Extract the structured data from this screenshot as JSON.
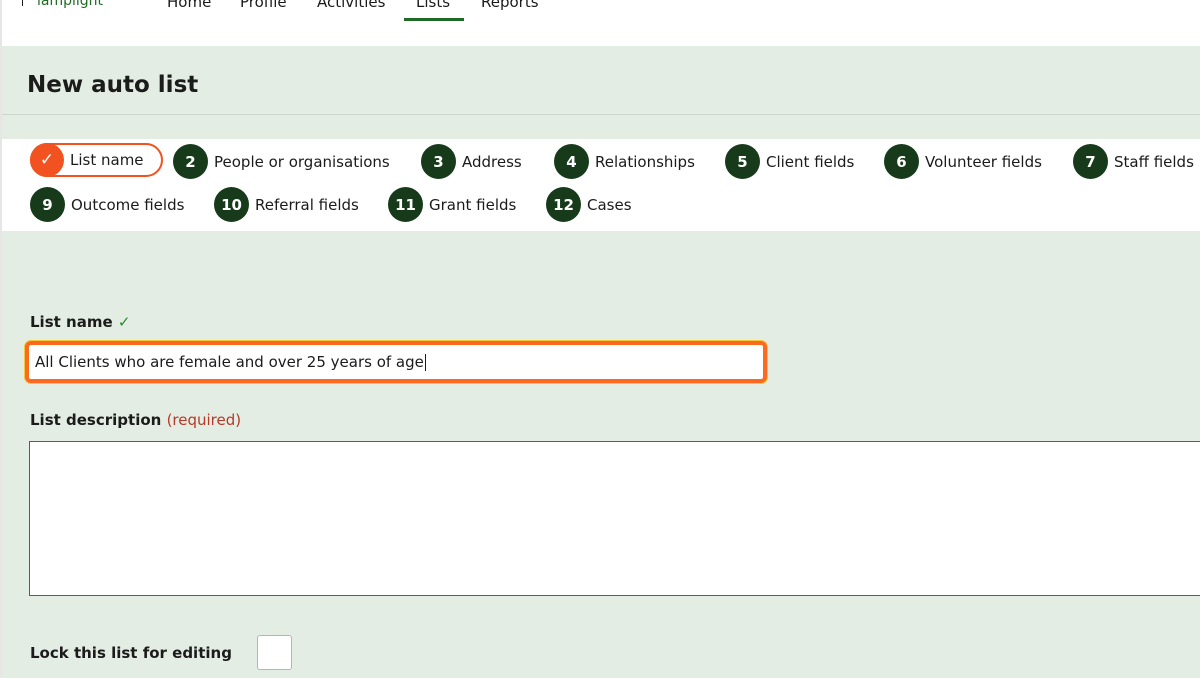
{
  "nav": {
    "logo": "lamplight",
    "items": [
      "Home",
      "Profile",
      "Activities",
      "Lists",
      "Reports"
    ],
    "active": "Lists"
  },
  "page": {
    "title": "New auto list"
  },
  "steps": [
    {
      "num": "✓",
      "label": "List name"
    },
    {
      "num": "2",
      "label": "People or organisations"
    },
    {
      "num": "3",
      "label": "Address"
    },
    {
      "num": "4",
      "label": "Relationships"
    },
    {
      "num": "5",
      "label": "Client fields"
    },
    {
      "num": "6",
      "label": "Volunteer fields"
    },
    {
      "num": "7",
      "label": "Staff fields"
    },
    {
      "num": "9",
      "label": "Outcome fields"
    },
    {
      "num": "10",
      "label": "Referral fields"
    },
    {
      "num": "11",
      "label": "Grant fields"
    },
    {
      "num": "12",
      "label": "Cases"
    }
  ],
  "form": {
    "list_name_label": "List name",
    "list_name_check": "✓",
    "list_name_value": "All Clients who are female and over 25 years of age",
    "description_label": "List description",
    "description_required": "(required)",
    "description_value": "",
    "lock_label": "Lock this list for editing"
  },
  "colors": {
    "brand_green": "#1f6b25",
    "step_dark": "#173b1a",
    "accent_orange": "#f2521f",
    "page_bg": "#e4ede3",
    "required_red": "#b33a2a"
  }
}
